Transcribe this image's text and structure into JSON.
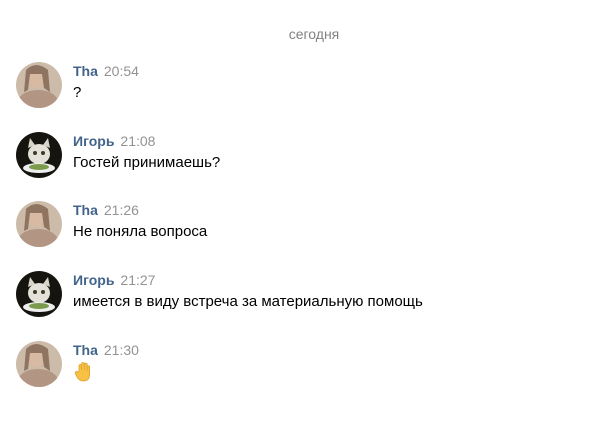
{
  "date_divider": "сегодня",
  "messages": [
    {
      "author": "Tha",
      "time": "20:54",
      "text": "?",
      "avatar": "user-photo-tha"
    },
    {
      "author": "Игорь",
      "time": "21:08",
      "text": "Гостей принимаешь?",
      "avatar": "cat-photo-igor"
    },
    {
      "author": "Tha",
      "time": "21:26",
      "text": "Не поняла вопроса",
      "avatar": "user-photo-tha"
    },
    {
      "author": "Игорь",
      "time": "21:27",
      "text": "имеется в виду встреча за материальную помощь",
      "avatar": "cat-photo-igor"
    },
    {
      "author": "Tha",
      "time": "21:30",
      "text": "",
      "emoji": "raised-hand-emoji",
      "avatar": "user-photo-tha"
    }
  ],
  "colors": {
    "author": "#42648b",
    "time": "#939393",
    "divider": "#828282",
    "text": "#000000"
  }
}
